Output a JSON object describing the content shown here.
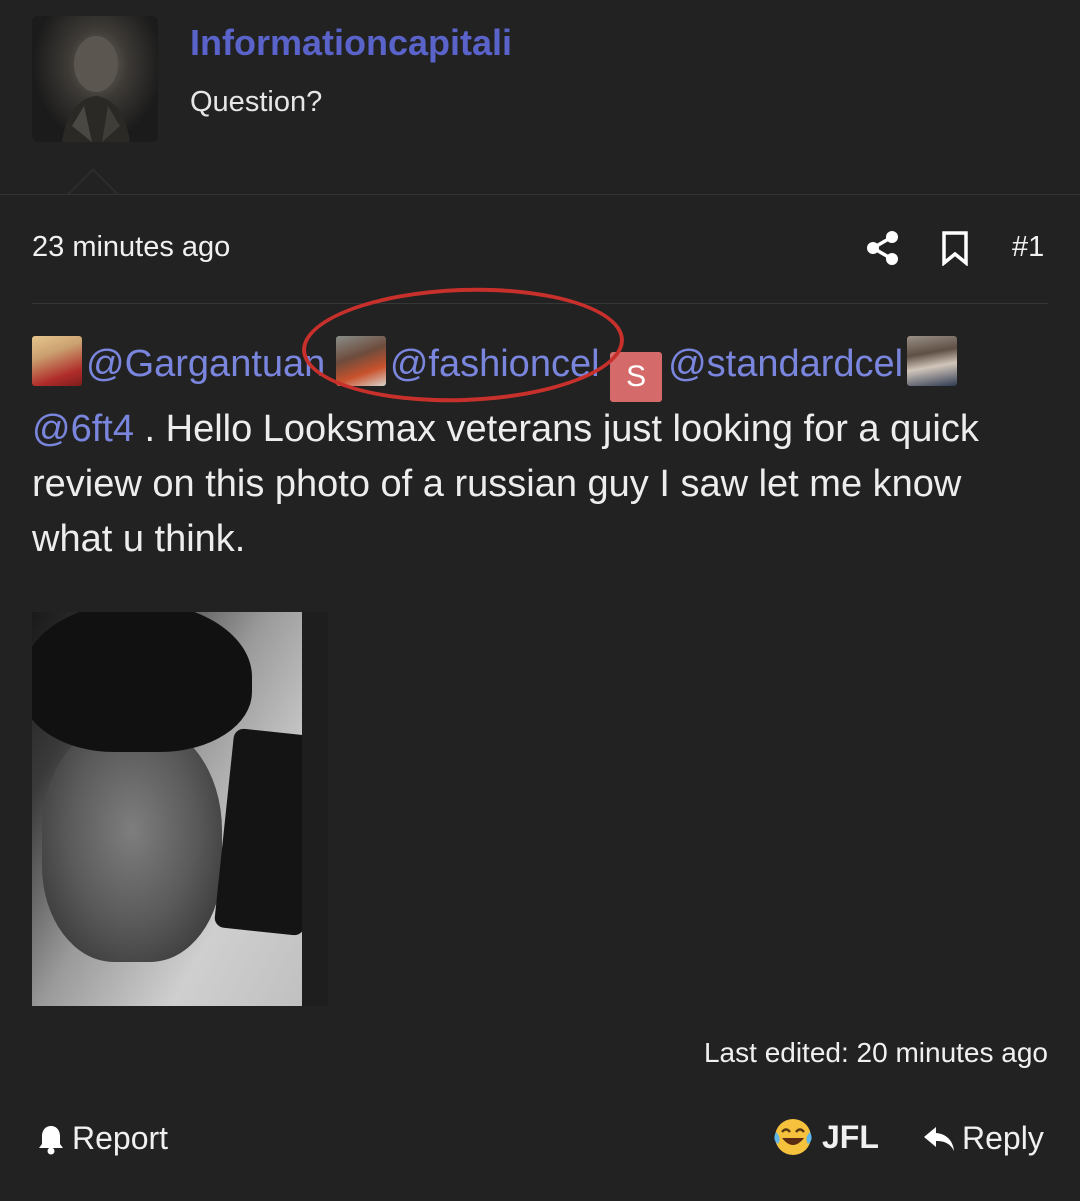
{
  "post": {
    "username": "Informationcapitali",
    "user_title": "Question?",
    "timestamp": "23 minutes ago",
    "post_number": "#1",
    "mentions": [
      "@Gargantuan",
      "@fashioncel",
      "@standardcel",
      "@6ft4"
    ],
    "mention_s_letter": "S",
    "body_text": " . Hello Looksmax veterans just looking for a quick review on this photo of a russian guy I saw let me know what u think.",
    "last_edited": "Last edited: 20 minutes ago"
  },
  "actions": {
    "report_label": "Report",
    "reaction_label": "JFL",
    "reply_label": "Reply"
  },
  "icons": {
    "share": "share-icon",
    "bookmark": "bookmark-icon",
    "report": "bell-icon",
    "reaction": "laughing-crying-emoji-icon",
    "reply": "reply-arrow-icon"
  },
  "colors": {
    "background": "#222222",
    "username": "#5a63c9",
    "mention": "#7a86dd",
    "annotation": "#c8302c",
    "s_avatar": "#d56a6a"
  }
}
